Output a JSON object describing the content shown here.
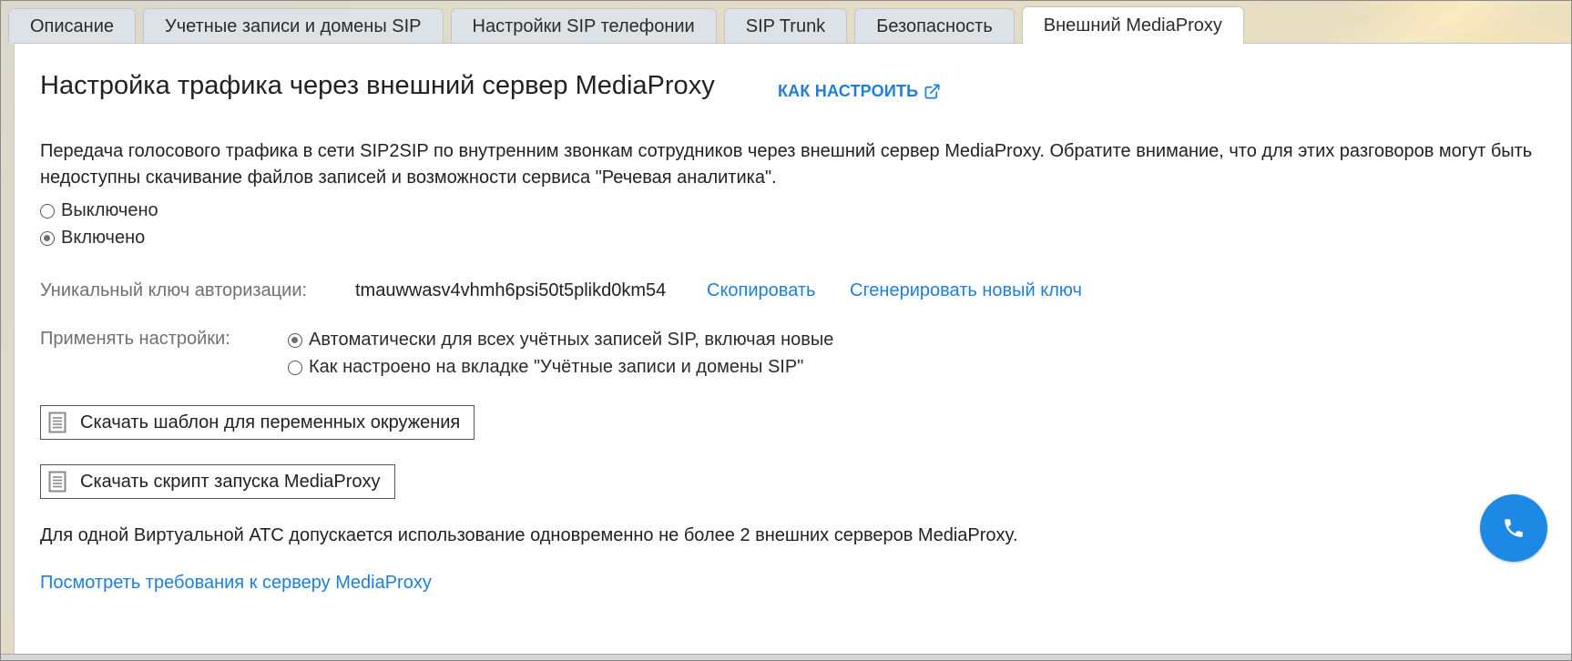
{
  "tabs": [
    {
      "label": "Описание",
      "active": false
    },
    {
      "label": "Учетные записи и домены SIP",
      "active": false
    },
    {
      "label": "Настройки SIP телефонии",
      "active": false
    },
    {
      "label": "SIP Trunk",
      "active": false
    },
    {
      "label": "Безопасность",
      "active": false
    },
    {
      "label": "Внешний MediaProxy",
      "active": true
    }
  ],
  "main": {
    "title": "Настройка трафика через внешний сервер MediaProxy",
    "howto_link": "КАК НАСТРОИТЬ",
    "description": "Передача голосового трафика в сети SIP2SIP по внутренним звонкам сотрудников через внешний сервер MediaProxy. Обратите внимание, что для этих разговоров могут быть недоступны скачивание файлов записей и возможности сервиса \"Речевая аналитика\".",
    "mode_options": [
      {
        "label": "Выключено",
        "checked": false
      },
      {
        "label": "Включено",
        "checked": true
      }
    ],
    "auth_key": {
      "label": "Уникальный ключ авторизации:",
      "value": "tmauwwasv4vhmh6psi50t5plikd0km54",
      "copy_label": "Скопировать",
      "generate_label": "Сгенерировать новый ключ"
    },
    "apply": {
      "label": "Применять настройки:",
      "options": [
        {
          "label": "Автоматически для всех учётных записей SIP, включая новые",
          "checked": true
        },
        {
          "label": "Как настроено на вкладке \"Учётные записи и домены SIP\"",
          "checked": false
        }
      ]
    },
    "download_env_label": "Скачать шаблон для переменных окружения",
    "download_script_label": "Скачать скрипт запуска MediaProxy",
    "note": "Для одной Виртуальной АТС допускается использование одновременно не более 2 внешних серверов MediaProxy.",
    "requirements_link": "Посмотреть требования к серверу MediaProxy"
  },
  "colors": {
    "link": "#1e7ed8",
    "fab": "#1e88e5",
    "tab_inactive": "#dde2e6"
  },
  "icons": {
    "howto": "external-link-icon",
    "download": "document-icon",
    "fab": "phone-icon"
  }
}
